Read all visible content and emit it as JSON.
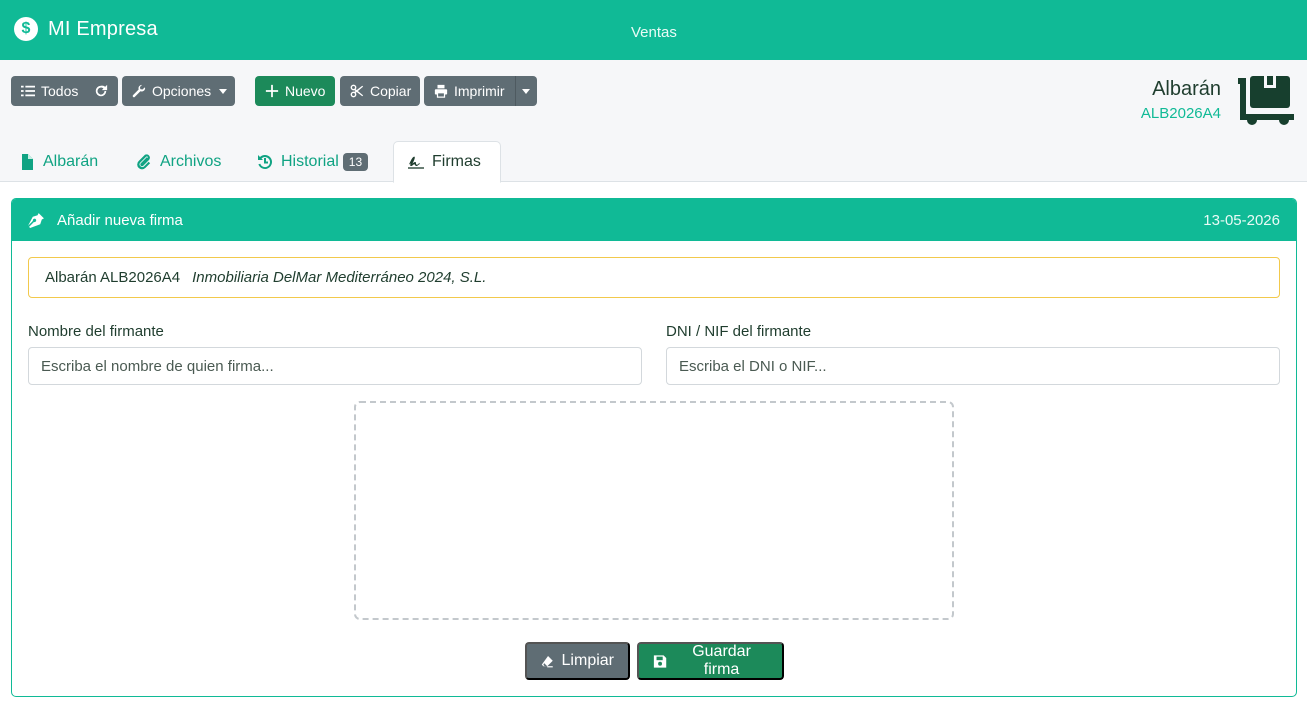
{
  "app": {
    "name": "MI Empresa",
    "nav_center": "Ventas"
  },
  "toolbar": {
    "todos": "Todos",
    "opciones": "Opciones",
    "nuevo": "Nuevo",
    "copiar": "Copiar",
    "imprimir": "Imprimir"
  },
  "document": {
    "title": "Albarán",
    "code": "ALB2026A4"
  },
  "tabs": [
    {
      "label": "Albarán",
      "active": false
    },
    {
      "label": "Archivos",
      "active": false
    },
    {
      "label": "Historial",
      "badge": "13",
      "active": false
    },
    {
      "label": "Firmas",
      "active": true
    }
  ],
  "panel": {
    "title": "Añadir nueva firma",
    "date": "13-05-2026",
    "info_doc": "Albarán ALB2026A4",
    "info_client": "Inmobiliaria DelMar Mediterráneo 2024, S.L.",
    "name_label": "Nombre del firmante",
    "name_placeholder": "Escriba el nombre de quien firma...",
    "name_value": "",
    "dni_label": "DNI / NIF del firmante",
    "dni_placeholder": "Escriba el DNI o NIF...",
    "dni_value": "",
    "clear_label": "Limpiar",
    "save_label": "Guardar firma"
  },
  "colors": {
    "brand": "#10ba96",
    "primary_button": "#1c8a5a",
    "secondary_button": "#5f6d74",
    "warning_border": "#f2c94c"
  },
  "icons": {
    "brand": "brand-logo-icon",
    "todos": "list-icon",
    "refresh": "refresh-icon",
    "opciones": "wrench-icon",
    "nuevo": "plus-icon",
    "copiar": "scissors-icon",
    "imprimir": "print-icon",
    "document": "dolly-box-icon",
    "tab_albaran": "file-icon",
    "tab_archivos": "paperclip-icon",
    "tab_historial": "history-icon",
    "tab_firmas": "signature-icon",
    "panel": "pen-nib-icon",
    "clear": "eraser-icon",
    "save": "save-icon"
  }
}
